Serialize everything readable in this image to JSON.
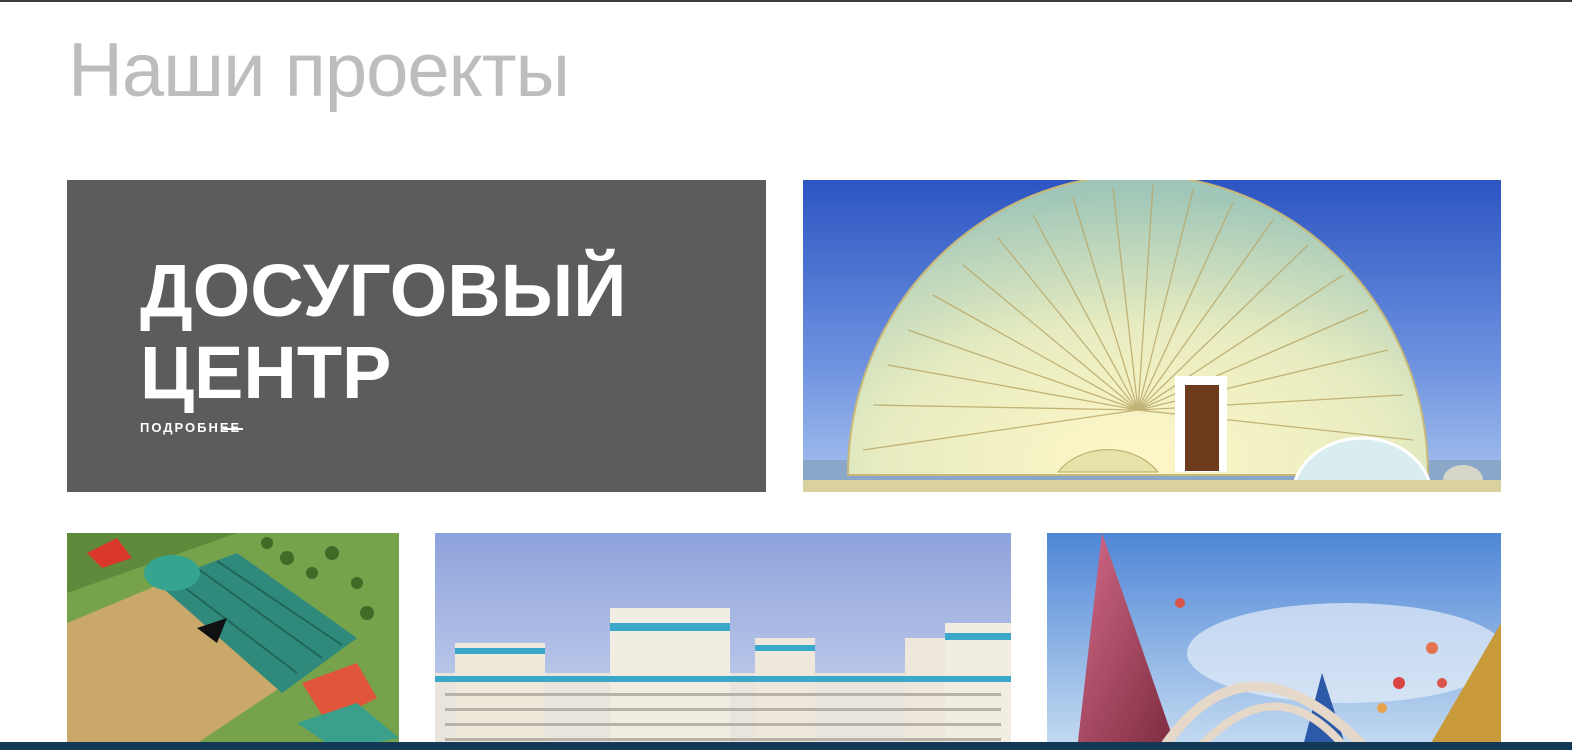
{
  "page": {
    "title": "Наши проекты"
  },
  "feature": {
    "title_line1": "ДОСУГОВЫЙ",
    "title_line2": "ЦЕНТР",
    "more_label": "ПОДРОБНЕЕ"
  },
  "projects": [
    {
      "name": "dome-project-image"
    },
    {
      "name": "stadium-project-image"
    },
    {
      "name": "housing-project-image"
    },
    {
      "name": "monument-project-image"
    }
  ],
  "colors": {
    "feature_bg": "#5c5c5c",
    "title_gray": "#bdbdbd",
    "sky_blue": "#3b67c7"
  }
}
